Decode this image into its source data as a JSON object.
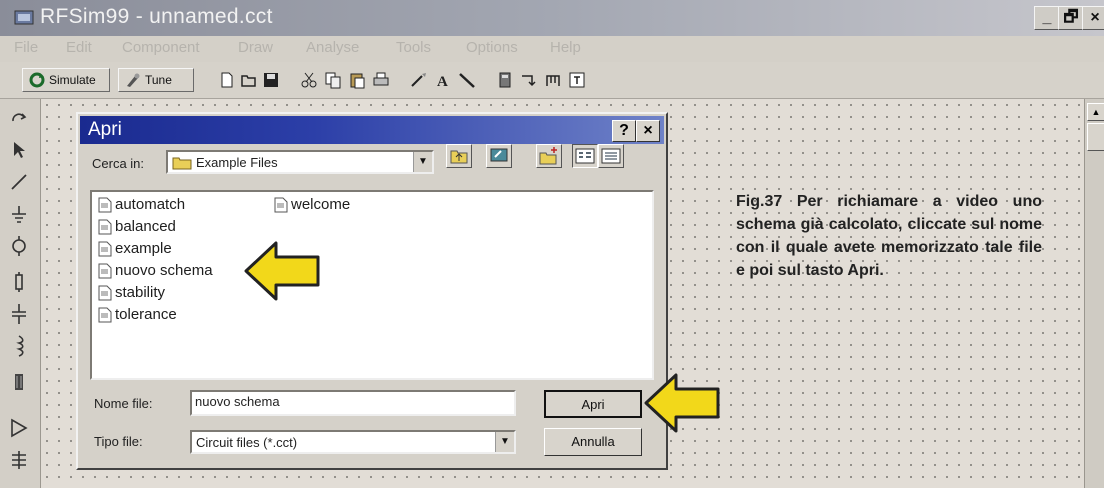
{
  "window": {
    "title": "RFSim99 - unnamed.cct",
    "buttons": {
      "minimize": "_",
      "maximize": "🗗",
      "close": "×"
    }
  },
  "menu": [
    "File",
    "Edit",
    "Component",
    "Draw",
    "Analyse",
    "Tools",
    "Options",
    "Help"
  ],
  "toolbar": {
    "simulate_label": "Simulate",
    "tune_label": "Tune",
    "icons": [
      "new-file-icon",
      "open-folder-icon",
      "save-icon",
      "cut-icon",
      "copy-icon",
      "paste-icon",
      "print-icon",
      "draw-wire-icon",
      "text-icon",
      "line-icon",
      "calculator-icon",
      "stub-icon",
      "component-icon",
      "info-icon"
    ]
  },
  "sidebar_icons": [
    "rotate-icon",
    "pointer-icon",
    "wire-icon",
    "ground-icon",
    "source-icon",
    "resistor-icon",
    "capacitor-icon",
    "inductor-icon",
    "transformer-icon",
    "amplifier-icon",
    "transistor-icon"
  ],
  "dialog": {
    "title": "Apri",
    "help_btn": "?",
    "close_btn": "×",
    "look_in_label": "Cerca in:",
    "look_in_value": "Example Files",
    "files": [
      "automatch",
      "balanced",
      "example",
      "nuovo schema",
      "stability",
      "tolerance",
      "welcome"
    ],
    "filename_label": "Nome file:",
    "filename_value": "nuovo schema",
    "filetype_label": "Tipo file:",
    "filetype_value": "Circuit files (*.cct)",
    "open_button": "Apri",
    "cancel_button": "Annulla"
  },
  "caption": "Fig.37 Per richiamare a video uno schema già calcolato, cliccate sul nome con il quale avete memorizzato tale file e poi sul tasto Apri.",
  "colors": {
    "dialog_title": "#1a2a8f",
    "arrow_fill": "#f2d81a",
    "arrow_outline": "#222222"
  }
}
